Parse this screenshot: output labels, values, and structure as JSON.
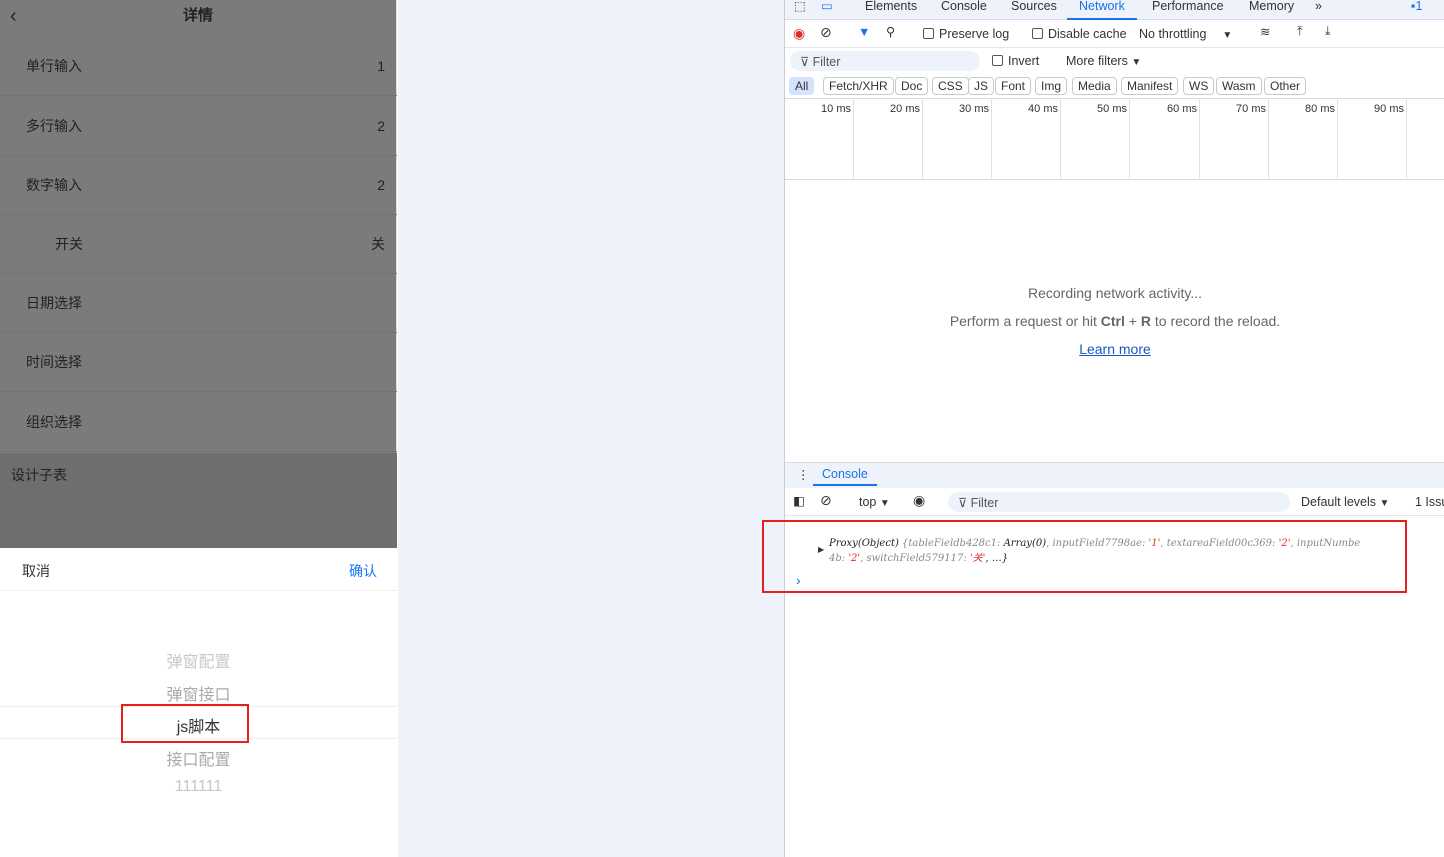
{
  "mobile": {
    "title": "详情",
    "back_icon": "‹",
    "rows": [
      {
        "label": "单行输入",
        "value": "1"
      },
      {
        "label": "多行输入",
        "value": "2"
      },
      {
        "label": "数字输入",
        "value": "2"
      },
      {
        "label": "开关",
        "value": "关"
      },
      {
        "label": "日期选择",
        "value": ""
      },
      {
        "label": "时间选择",
        "value": ""
      },
      {
        "label": "组织选择",
        "value": ""
      }
    ],
    "subtable": "设计子表",
    "picker": {
      "cancel": "取消",
      "confirm": "确认",
      "options": [
        "弹窗配置",
        "弹窗接口",
        "js脚本",
        "接口配置",
        "111111"
      ],
      "selected": "js脚本"
    }
  },
  "devtools": {
    "tabs": [
      "Elements",
      "Console",
      "Sources",
      "Network",
      "Performance",
      "Memory"
    ],
    "active_tab": "Network",
    "more": "»",
    "issues_badge": "1",
    "toolbar": {
      "preserve_log": "Preserve log",
      "disable_cache": "Disable cache",
      "throttling": "No throttling"
    },
    "filter": {
      "placeholder": "Filter",
      "invert": "Invert",
      "more_filters": "More filters"
    },
    "types": [
      "All",
      "Fetch/XHR",
      "Doc",
      "CSS",
      "JS",
      "Font",
      "Img",
      "Media",
      "Manifest",
      "WS",
      "Wasm",
      "Other"
    ],
    "ticks": [
      "10 ms",
      "20 ms",
      "30 ms",
      "40 ms",
      "50 ms",
      "60 ms",
      "70 ms",
      "80 ms",
      "90 ms"
    ],
    "empty": {
      "line1": "Recording network activity...",
      "line2a": "Perform a request or hit ",
      "ctrl": "Ctrl",
      "plus": " + ",
      "r": "R",
      "line2b": " to record the reload.",
      "learn": "Learn more"
    },
    "console": {
      "tab": "Console",
      "context": "top",
      "filter": "Filter",
      "levels": "Default levels",
      "issues": "1 Issu",
      "log1": "Proxy(Object)",
      "log_rest": " {tableFieldb428c1: ",
      "arr": "Array(0)",
      "p1": ", inputField7798ae: ",
      "v1": "'1'",
      "p2": ", textareaField00c369: ",
      "v2": "'2'",
      "p3": ", inputNumbe",
      "l2a": "4b: ",
      "l2v": "'2'",
      "l2b": ", switchField579117: ",
      "l2v2": "'关'",
      "l2c": ",  …}",
      "prompt": "›"
    }
  }
}
